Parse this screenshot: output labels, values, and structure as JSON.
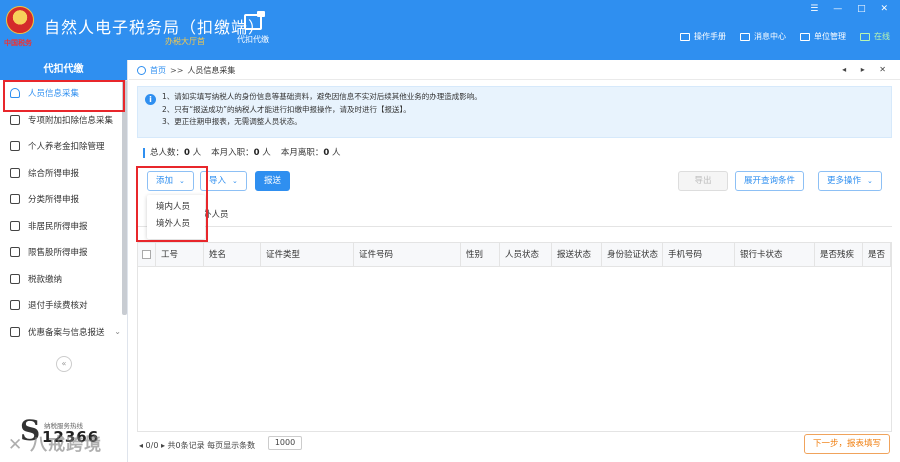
{
  "header": {
    "logo_text": "中国税务",
    "title": "自然人电子税务局（扣缴端）",
    "nav": [
      {
        "label": "办税大厅首",
        "icon": "hall-icon"
      },
      {
        "label": "代扣代缴",
        "icon": "proxy-withhold-icon"
      }
    ],
    "window_controls": "☰ — □ ✕",
    "tools": [
      {
        "label": "操作手册",
        "icon": "manual-icon"
      },
      {
        "label": "消息中心",
        "icon": "message-icon"
      },
      {
        "label": "单位管理",
        "icon": "unit-icon"
      },
      {
        "label": "在线",
        "icon": "online-icon",
        "color": "#b8f5b0"
      }
    ],
    "accent": "#2f8ff0"
  },
  "sidebar": {
    "title": "代扣代缴",
    "items": [
      {
        "label": "人员信息采集",
        "icon": "person-icon",
        "active": true
      },
      {
        "label": "专项附加扣除信息采集",
        "icon": "list-icon"
      },
      {
        "label": "个人养老金扣除管理",
        "icon": "pension-icon"
      },
      {
        "label": "综合所得申报",
        "icon": "layers-icon"
      },
      {
        "label": "分类所得申报",
        "icon": "pie-icon"
      },
      {
        "label": "非居民所得申报",
        "icon": "nonresident-icon"
      },
      {
        "label": "限售股所得申报",
        "icon": "stock-icon"
      },
      {
        "label": "税款缴纳",
        "icon": "payment-icon"
      },
      {
        "label": "退付手续费核对",
        "icon": "refund-icon"
      },
      {
        "label": "优惠备案与信息报送",
        "icon": "filing-icon",
        "expandable": true
      }
    ],
    "collapse": "«",
    "hotline_label": "纳税服务热线",
    "hotline_number": "12366",
    "hotline_mark": "S"
  },
  "watermark": "✕ 八戒跨境",
  "breadcrumb": {
    "home": "首页",
    "separator": ">>",
    "current": "人员信息采集",
    "controls": "◂ ▸ ✕"
  },
  "notice": {
    "icon": "i",
    "lines": [
      "1、请如实填写纳税人的身份信息等基础资料，避免因信息不实对后续其他业务的办理造成影响。",
      "2、只有“报送成功”的纳税人才能进行扣缴申报操作，请及时进行【报送】。",
      "3、更正往期申报表，无需调整人员状态。"
    ]
  },
  "stats": {
    "total_label": "总人数：",
    "total_value": "0",
    "hired_label": "本月入职：",
    "hired_value": "0",
    "left_label": "本月离职：",
    "left_value": "0",
    "unit": "人"
  },
  "toolbar": {
    "add": "添加",
    "import": "导入",
    "submit": "报送",
    "export": "导出",
    "expand_query": "展开查询条件",
    "more": "更多操作"
  },
  "add_menu": {
    "options": [
      "境内人员",
      "境外人员"
    ]
  },
  "subtabs": {
    "foreign": "外人员"
  },
  "table": {
    "columns": [
      "工号",
      "姓名",
      "证件类型",
      "证件号码",
      "性别",
      "人员状态",
      "报送状态",
      "身份验证状态",
      "手机号码",
      "银行卡状态",
      "是否残疾",
      "是否"
    ],
    "rows": []
  },
  "footer": {
    "pager": "◂ 0/0 ▸ 共0条记录  每页显示条数",
    "page_size": "1000",
    "next": "下一步，报表填写"
  }
}
